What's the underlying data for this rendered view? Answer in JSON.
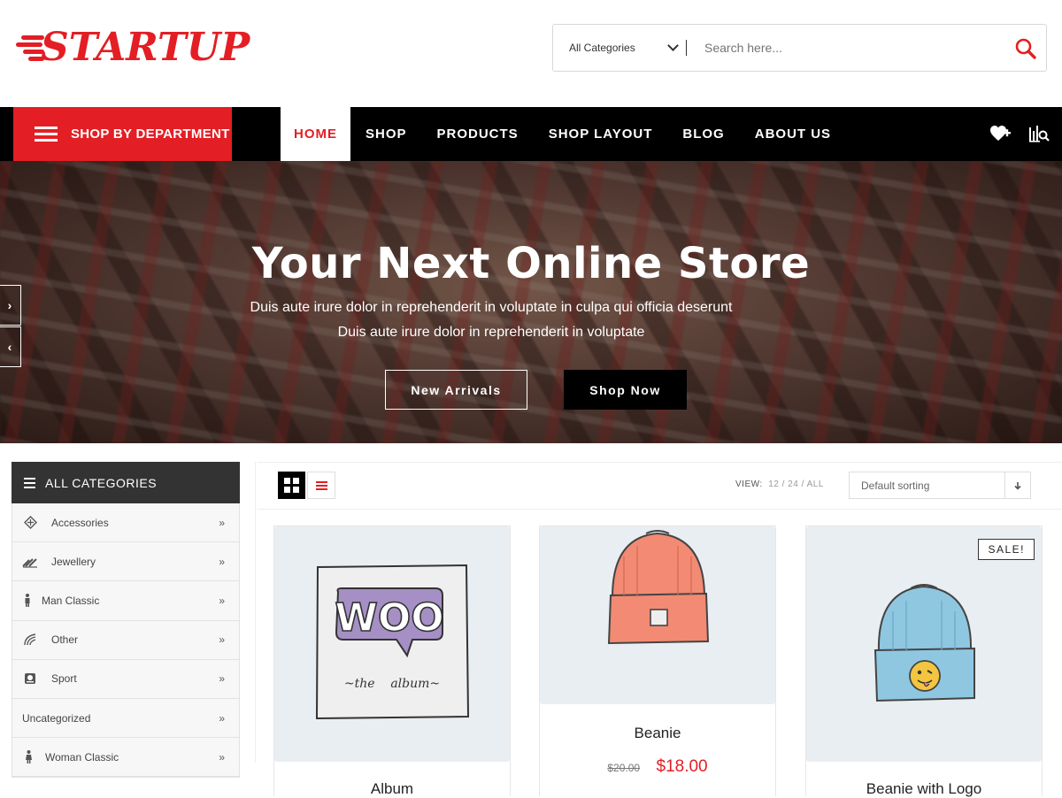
{
  "brand": {
    "logo_text": "STARTUP"
  },
  "search": {
    "category": "All Categories",
    "placeholder": "Search here..."
  },
  "nav": {
    "department_label": "SHOP BY DEPARTMENT",
    "items": [
      {
        "label": "HOME",
        "active": true
      },
      {
        "label": "SHOP"
      },
      {
        "label": "PRODUCTS"
      },
      {
        "label": "SHOP LAYOUT"
      },
      {
        "label": "BLOG"
      },
      {
        "label": "ABOUT US"
      }
    ],
    "icons": [
      "wishlist-heart-icon",
      "compare-icon"
    ]
  },
  "hero": {
    "title": "Your Next Online Store",
    "line1": "Duis aute irure dolor in reprehenderit in voluptate in culpa qui officia deserunt",
    "line2": "Duis aute irure dolor in reprehenderit in voluptate",
    "btn_outline": "New Arrivals",
    "btn_solid": "Shop Now"
  },
  "sidebar": {
    "title": "ALL CATEGORIES",
    "items": [
      {
        "label": "Accessories",
        "icon": "accessories-icon"
      },
      {
        "label": "Jewellery",
        "icon": "jewellery-icon"
      },
      {
        "label": "Man Classic",
        "icon": "man-icon"
      },
      {
        "label": "Other",
        "icon": "other-icon"
      },
      {
        "label": "Sport",
        "icon": "sport-icon"
      },
      {
        "label": "Uncategorized",
        "icon": ""
      },
      {
        "label": "Woman Classic",
        "icon": "woman-icon"
      }
    ],
    "more_glyph": "»"
  },
  "toolbar": {
    "view_label": "VIEW:",
    "view_options": "12 / 24 / ALL",
    "sort_value": "Default sorting"
  },
  "products": [
    {
      "name": "Album"
    },
    {
      "name": "Beanie",
      "old_price": "$20.00",
      "price": "$18.00"
    },
    {
      "name": "Beanie with Logo",
      "badge": "SALE!"
    }
  ],
  "colors": {
    "accent": "#e31e24",
    "nav_bg": "#000000",
    "sidebar_head": "#333333"
  }
}
